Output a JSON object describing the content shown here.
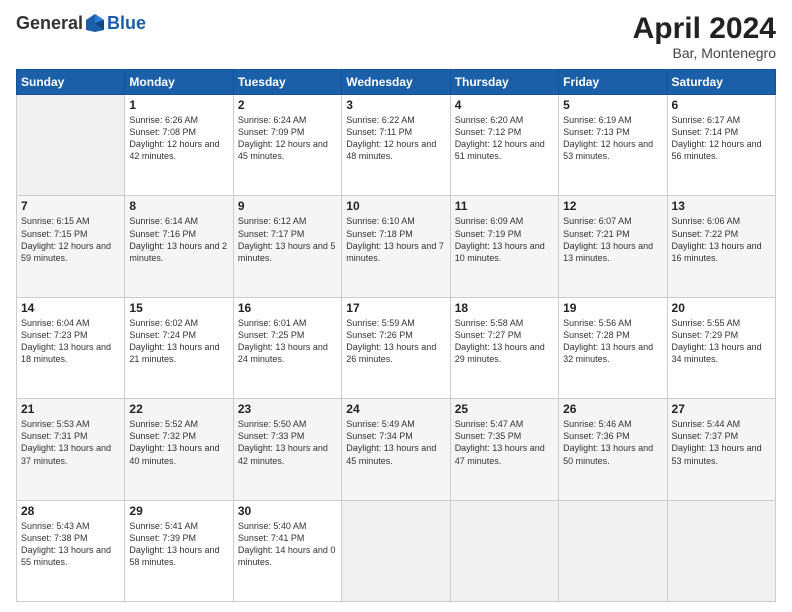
{
  "logo": {
    "general": "General",
    "blue": "Blue"
  },
  "header": {
    "month": "April 2024",
    "location": "Bar, Montenegro"
  },
  "weekdays": [
    "Sunday",
    "Monday",
    "Tuesday",
    "Wednesday",
    "Thursday",
    "Friday",
    "Saturday"
  ],
  "rows": [
    [
      {
        "day": "",
        "sunrise": "",
        "sunset": "",
        "daylight": ""
      },
      {
        "day": "1",
        "sunrise": "Sunrise: 6:26 AM",
        "sunset": "Sunset: 7:08 PM",
        "daylight": "Daylight: 12 hours and 42 minutes."
      },
      {
        "day": "2",
        "sunrise": "Sunrise: 6:24 AM",
        "sunset": "Sunset: 7:09 PM",
        "daylight": "Daylight: 12 hours and 45 minutes."
      },
      {
        "day": "3",
        "sunrise": "Sunrise: 6:22 AM",
        "sunset": "Sunset: 7:11 PM",
        "daylight": "Daylight: 12 hours and 48 minutes."
      },
      {
        "day": "4",
        "sunrise": "Sunrise: 6:20 AM",
        "sunset": "Sunset: 7:12 PM",
        "daylight": "Daylight: 12 hours and 51 minutes."
      },
      {
        "day": "5",
        "sunrise": "Sunrise: 6:19 AM",
        "sunset": "Sunset: 7:13 PM",
        "daylight": "Daylight: 12 hours and 53 minutes."
      },
      {
        "day": "6",
        "sunrise": "Sunrise: 6:17 AM",
        "sunset": "Sunset: 7:14 PM",
        "daylight": "Daylight: 12 hours and 56 minutes."
      }
    ],
    [
      {
        "day": "7",
        "sunrise": "Sunrise: 6:15 AM",
        "sunset": "Sunset: 7:15 PM",
        "daylight": "Daylight: 12 hours and 59 minutes."
      },
      {
        "day": "8",
        "sunrise": "Sunrise: 6:14 AM",
        "sunset": "Sunset: 7:16 PM",
        "daylight": "Daylight: 13 hours and 2 minutes."
      },
      {
        "day": "9",
        "sunrise": "Sunrise: 6:12 AM",
        "sunset": "Sunset: 7:17 PM",
        "daylight": "Daylight: 13 hours and 5 minutes."
      },
      {
        "day": "10",
        "sunrise": "Sunrise: 6:10 AM",
        "sunset": "Sunset: 7:18 PM",
        "daylight": "Daylight: 13 hours and 7 minutes."
      },
      {
        "day": "11",
        "sunrise": "Sunrise: 6:09 AM",
        "sunset": "Sunset: 7:19 PM",
        "daylight": "Daylight: 13 hours and 10 minutes."
      },
      {
        "day": "12",
        "sunrise": "Sunrise: 6:07 AM",
        "sunset": "Sunset: 7:21 PM",
        "daylight": "Daylight: 13 hours and 13 minutes."
      },
      {
        "day": "13",
        "sunrise": "Sunrise: 6:06 AM",
        "sunset": "Sunset: 7:22 PM",
        "daylight": "Daylight: 13 hours and 16 minutes."
      }
    ],
    [
      {
        "day": "14",
        "sunrise": "Sunrise: 6:04 AM",
        "sunset": "Sunset: 7:23 PM",
        "daylight": "Daylight: 13 hours and 18 minutes."
      },
      {
        "day": "15",
        "sunrise": "Sunrise: 6:02 AM",
        "sunset": "Sunset: 7:24 PM",
        "daylight": "Daylight: 13 hours and 21 minutes."
      },
      {
        "day": "16",
        "sunrise": "Sunrise: 6:01 AM",
        "sunset": "Sunset: 7:25 PM",
        "daylight": "Daylight: 13 hours and 24 minutes."
      },
      {
        "day": "17",
        "sunrise": "Sunrise: 5:59 AM",
        "sunset": "Sunset: 7:26 PM",
        "daylight": "Daylight: 13 hours and 26 minutes."
      },
      {
        "day": "18",
        "sunrise": "Sunrise: 5:58 AM",
        "sunset": "Sunset: 7:27 PM",
        "daylight": "Daylight: 13 hours and 29 minutes."
      },
      {
        "day": "19",
        "sunrise": "Sunrise: 5:56 AM",
        "sunset": "Sunset: 7:28 PM",
        "daylight": "Daylight: 13 hours and 32 minutes."
      },
      {
        "day": "20",
        "sunrise": "Sunrise: 5:55 AM",
        "sunset": "Sunset: 7:29 PM",
        "daylight": "Daylight: 13 hours and 34 minutes."
      }
    ],
    [
      {
        "day": "21",
        "sunrise": "Sunrise: 5:53 AM",
        "sunset": "Sunset: 7:31 PM",
        "daylight": "Daylight: 13 hours and 37 minutes."
      },
      {
        "day": "22",
        "sunrise": "Sunrise: 5:52 AM",
        "sunset": "Sunset: 7:32 PM",
        "daylight": "Daylight: 13 hours and 40 minutes."
      },
      {
        "day": "23",
        "sunrise": "Sunrise: 5:50 AM",
        "sunset": "Sunset: 7:33 PM",
        "daylight": "Daylight: 13 hours and 42 minutes."
      },
      {
        "day": "24",
        "sunrise": "Sunrise: 5:49 AM",
        "sunset": "Sunset: 7:34 PM",
        "daylight": "Daylight: 13 hours and 45 minutes."
      },
      {
        "day": "25",
        "sunrise": "Sunrise: 5:47 AM",
        "sunset": "Sunset: 7:35 PM",
        "daylight": "Daylight: 13 hours and 47 minutes."
      },
      {
        "day": "26",
        "sunrise": "Sunrise: 5:46 AM",
        "sunset": "Sunset: 7:36 PM",
        "daylight": "Daylight: 13 hours and 50 minutes."
      },
      {
        "day": "27",
        "sunrise": "Sunrise: 5:44 AM",
        "sunset": "Sunset: 7:37 PM",
        "daylight": "Daylight: 13 hours and 53 minutes."
      }
    ],
    [
      {
        "day": "28",
        "sunrise": "Sunrise: 5:43 AM",
        "sunset": "Sunset: 7:38 PM",
        "daylight": "Daylight: 13 hours and 55 minutes."
      },
      {
        "day": "29",
        "sunrise": "Sunrise: 5:41 AM",
        "sunset": "Sunset: 7:39 PM",
        "daylight": "Daylight: 13 hours and 58 minutes."
      },
      {
        "day": "30",
        "sunrise": "Sunrise: 5:40 AM",
        "sunset": "Sunset: 7:41 PM",
        "daylight": "Daylight: 14 hours and 0 minutes."
      },
      {
        "day": "",
        "sunrise": "",
        "sunset": "",
        "daylight": ""
      },
      {
        "day": "",
        "sunrise": "",
        "sunset": "",
        "daylight": ""
      },
      {
        "day": "",
        "sunrise": "",
        "sunset": "",
        "daylight": ""
      },
      {
        "day": "",
        "sunrise": "",
        "sunset": "",
        "daylight": ""
      }
    ]
  ]
}
